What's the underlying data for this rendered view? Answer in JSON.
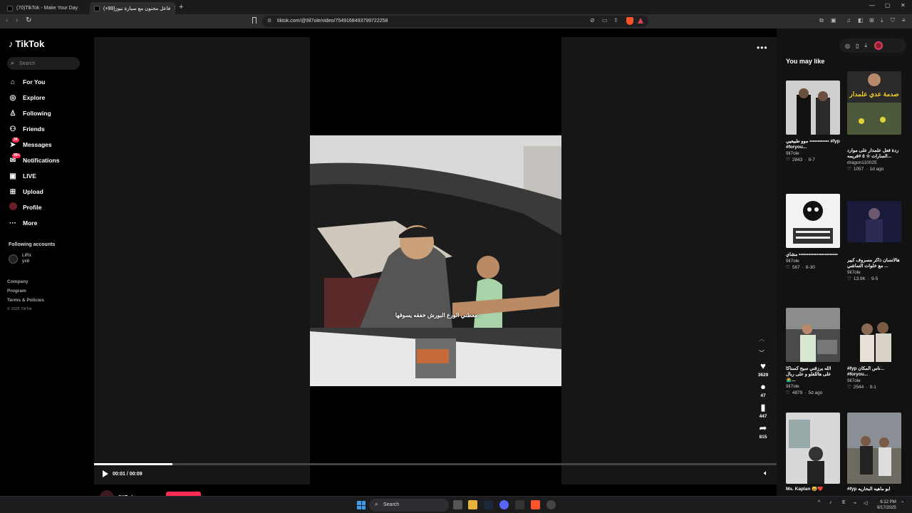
{
  "browser": {
    "tabs": [
      {
        "title": "(70)TikTok - Make Your Day"
      },
      {
        "title": "(+99)فاعل مجنون مع سيارة نيوز"
      }
    ],
    "url": "tiktok.com/@9il7ole/video/7549168493799722258"
  },
  "sidebar": {
    "logo": "TikTok",
    "search_placeholder": "Search",
    "nav": [
      {
        "label": "For You",
        "icon": "home-icon"
      },
      {
        "label": "Explore",
        "icon": "compass-icon"
      },
      {
        "label": "Following",
        "icon": "person-plus-icon"
      },
      {
        "label": "Friends",
        "icon": "friends-icon"
      },
      {
        "label": "Messages",
        "icon": "send-icon",
        "badge": "34"
      },
      {
        "label": "Notifications",
        "icon": "bell-icon",
        "badge": "99+"
      },
      {
        "label": "LIVE",
        "icon": "live-icon"
      },
      {
        "label": "Upload",
        "icon": "plus-square-icon"
      },
      {
        "label": "Profile",
        "icon": "profile-avatar"
      },
      {
        "label": "More",
        "icon": "more-icon"
      }
    ],
    "following_heading": "Following accounts",
    "following_accounts": [
      {
        "name": "LiRx",
        "handle": "yx8"
      }
    ],
    "footer_links": [
      "Company",
      "Program",
      "Terms & Policies"
    ],
    "copyright": "© 2025 TikTok"
  },
  "video": {
    "caption": "معطني الورع البورش خفقه يسوقها :",
    "current_time": "00:01 / 00:09",
    "progress_fraction": 0.115,
    "likes": "3629",
    "comments": "47",
    "saves": "447",
    "shares": "815",
    "author": "9il7ole"
  },
  "right_panel": {
    "heading": "You may like",
    "cards": [
      {
        "title": "موو طبيعيي •••••••••••• #fyp #foryou...",
        "author": "9il7ole",
        "likes": "2843",
        "date": "9-7"
      },
      {
        "title": "ردة فعل علمدار على موارد السارات ☆ ٥ #فريمه...",
        "author": "dragon110025",
        "likes": "1057",
        "date": "1d ago",
        "thumb_text": "صدمة عدي علمدار"
      },
      {
        "title": "مشاي ••••••••••••••••••••••••",
        "author": "9il7ole",
        "likes": "567",
        "date": "8-30"
      },
      {
        "title": "هالانسان ذاكر مسروف كبير مع خلوات التماشي ...",
        "author": "9il7ole",
        "likes": "13.9K",
        "date": "9-5"
      },
      {
        "title": "الله يرزقني سيح كسناكا على هاللفلو و على ربال 🤷‍♂️...",
        "author": "9il7ole",
        "likes": "4879",
        "date": "5d ago"
      },
      {
        "title": "#fyp ناس المكان... #foryou...",
        "author": "9il7ole",
        "likes": "2544",
        "date": "9-1"
      },
      {
        "title": "Ms. Kaplan 😅❤️",
        "author": "",
        "likes": "",
        "date": ""
      },
      {
        "title": "#fyp ابو ماهيه البحاريه",
        "author": "",
        "likes": "",
        "date": ""
      }
    ]
  },
  "taskbar": {
    "search_label": "Search",
    "time": "6:12 PM",
    "date": "9/17/2025"
  }
}
